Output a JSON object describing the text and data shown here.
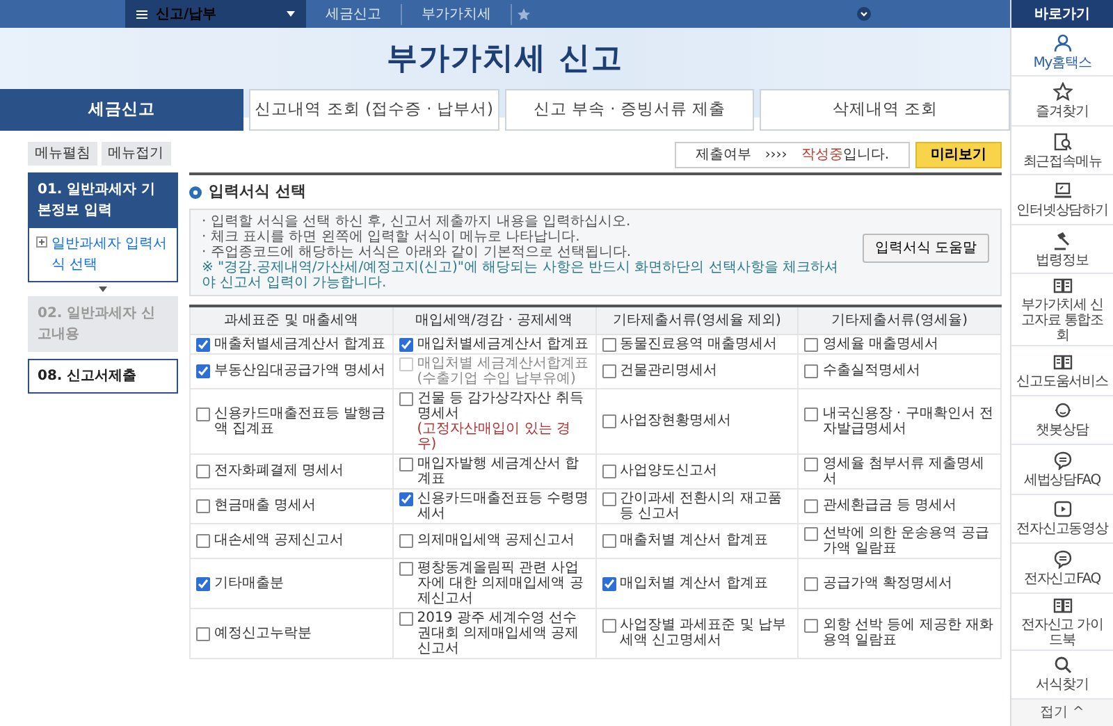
{
  "top_bar": {
    "menu_label": "신고/납부",
    "breadcrumbs": [
      "세금신고",
      "부가가치세"
    ]
  },
  "page_title": "부가가치세 신고",
  "tabs": [
    {
      "label": "세금신고",
      "selected": true
    },
    {
      "label": "신고내역 조회 (접수증 · 납부서)",
      "selected": false
    },
    {
      "label": "신고 부속 · 증빙서류 제출",
      "selected": false
    },
    {
      "label": "삭제내역 조회",
      "selected": false
    }
  ],
  "side_nav": {
    "buttons": [
      "메뉴펼침",
      "메뉴접기"
    ],
    "steps": [
      {
        "label": "01. 일반과세자 기본정보 입력",
        "selected": true,
        "disabled": false,
        "expanded": true,
        "children": [
          {
            "label": "일반과세자 입력서식 선택"
          }
        ]
      },
      {
        "label": "02. 일반과세자 신고내용",
        "selected": false,
        "disabled": true
      },
      {
        "label": "08. 신고서제출",
        "selected": false,
        "disabled": false
      }
    ]
  },
  "status": {
    "label": "제출여부",
    "arrows": "››››",
    "value_highlight": "작성중",
    "value_rest": "입니다.",
    "preview_button": "미리보기"
  },
  "section_title": "입력서식 선택",
  "info": {
    "lines": [
      "· 입력할 서식을 선택 하신 후, 신고서 제출까지 내용을 입력하십시오.",
      "· 체크 표시를 하면 왼쪽에 입력할 서식이 메뉴로 나타납니다.",
      "· 주업종코드에 해당하는 서식은 아래와 같이 기본적으로 선택됩니다."
    ],
    "notice": "※ \"경감.공제내역/가산세/예정고지(신고)\"에 해당되는 사항은 반드시 화면하단의 선택사항을 체크하셔야 신고서 입력이 가능합니다.",
    "help_button": "입력서식 도움말"
  },
  "table": {
    "columns": [
      "과세표준 및 매출세액",
      "매입세액/경감 · 공제세액",
      "기타제출서류(영세율 제외)",
      "기타제출서류(영세율)"
    ],
    "rows": [
      [
        {
          "label": "매출처별세금계산서 합계표",
          "checked": true,
          "disabled": false
        },
        {
          "label": "매입처별세금계산서 합계표",
          "checked": true,
          "disabled": false
        },
        {
          "label": "동물진료용역 매출명세서",
          "checked": false,
          "disabled": false
        },
        {
          "label": "영세율 매출명세서",
          "checked": false,
          "disabled": false
        }
      ],
      [
        {
          "label": "부동산임대공급가액 명세서",
          "checked": true,
          "disabled": false
        },
        {
          "label": "매입처별 세금계산서합계표 (수출기업 수입 납부유예)",
          "checked": false,
          "disabled": true
        },
        {
          "label": "건물관리명세서",
          "checked": false,
          "disabled": false
        },
        {
          "label": "수출실적명세서",
          "checked": false,
          "disabled": false
        }
      ],
      [
        {
          "label": "신용카드매출전표등 발행금액 집계표",
          "checked": false,
          "disabled": false
        },
        {
          "label": "건물 등 감가상각자산 취득명세서",
          "note": "(고정자산매입이 있는 경우)",
          "checked": false,
          "disabled": false
        },
        {
          "label": "사업장현황명세서",
          "checked": false,
          "disabled": false
        },
        {
          "label": "내국신용장 · 구매확인서 전자발급명세서",
          "checked": false,
          "disabled": false
        }
      ],
      [
        {
          "label": "전자화폐결제 명세서",
          "checked": false,
          "disabled": false
        },
        {
          "label": "매입자발행 세금계산서 합계표",
          "checked": false,
          "disabled": false
        },
        {
          "label": "사업양도신고서",
          "checked": false,
          "disabled": false
        },
        {
          "label": "영세율 첨부서류 제출명세서",
          "checked": false,
          "disabled": false
        }
      ],
      [
        {
          "label": "현금매출 명세서",
          "checked": false,
          "disabled": false
        },
        {
          "label": "신용카드매출전표등 수령명세서",
          "checked": true,
          "disabled": false
        },
        {
          "label": "간이과세 전환시의 재고품등 신고서",
          "checked": false,
          "disabled": false
        },
        {
          "label": "관세환급금 등 명세서",
          "checked": false,
          "disabled": false
        }
      ],
      [
        {
          "label": "대손세액 공제신고서",
          "checked": false,
          "disabled": false
        },
        {
          "label": "의제매입세액 공제신고서",
          "checked": false,
          "disabled": false
        },
        {
          "label": "매출처별 계산서 합계표",
          "checked": false,
          "disabled": false
        },
        {
          "label": "선박에 의한 운송용역 공급가액 일람표",
          "checked": false,
          "disabled": false
        }
      ],
      [
        {
          "label": "기타매출분",
          "checked": true,
          "disabled": false
        },
        {
          "label": "평창동계올림픽 관련 사업자에 대한 의제매입세액 공제신고서",
          "checked": false,
          "disabled": false
        },
        {
          "label": "매입처별 계산서 합계표",
          "checked": true,
          "disabled": false
        },
        {
          "label": "공급가액 확정명세서",
          "checked": false,
          "disabled": false
        }
      ],
      [
        {
          "label": "예정신고누락분",
          "checked": false,
          "disabled": false
        },
        {
          "label": "2019 광주 세계수영 선수권대회 의제매입세액 공제신고서",
          "checked": false,
          "disabled": false
        },
        {
          "label": "사업장별 과세표준 및 납부세액 신고명세서",
          "checked": false,
          "disabled": false
        },
        {
          "label": "외항 선박 등에 제공한 재화용역 일람표",
          "checked": false,
          "disabled": false
        }
      ]
    ]
  },
  "quick_menu": {
    "title": "바로가기",
    "items": [
      {
        "label": "My홈택스",
        "kind": "person",
        "selected": true
      },
      {
        "label": "즐겨찾기",
        "kind": "star",
        "selected": false
      },
      {
        "label": "최근접속메뉴",
        "kind": "doc-search",
        "selected": false
      },
      {
        "label": "인터넷상담하기",
        "kind": "laptop",
        "selected": false
      },
      {
        "label": "법령정보",
        "kind": "gavel",
        "selected": false
      },
      {
        "label": "부가가치세 신고자료 통합조회",
        "kind": "book",
        "selected": false
      },
      {
        "label": "신고도움서비스",
        "kind": "book",
        "selected": false
      },
      {
        "label": "챗봇상담",
        "kind": "bot",
        "selected": false
      },
      {
        "label": "세법상담FAQ",
        "kind": "bubble",
        "selected": false
      },
      {
        "label": "전자신고동영상",
        "kind": "play",
        "selected": false
      },
      {
        "label": "전자신고FAQ",
        "kind": "bubble",
        "selected": false
      },
      {
        "label": "전자신고 가이드북",
        "kind": "book",
        "selected": false
      },
      {
        "label": "서식찾기",
        "kind": "search",
        "selected": false
      }
    ],
    "collapse": "접기 ^"
  }
}
